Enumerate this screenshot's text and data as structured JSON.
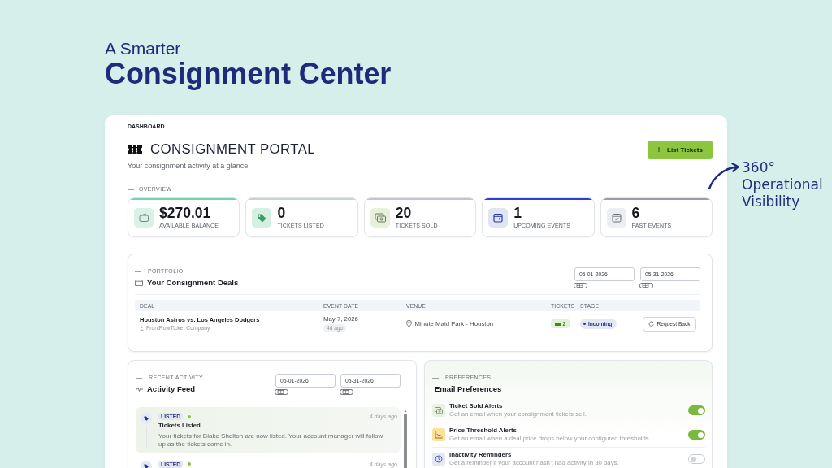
{
  "hero": {
    "kicker": "A Smarter",
    "title": "Consignment Center"
  },
  "annotation": {
    "text": "360° Operational Visibility"
  },
  "breadcrumb": "DASHBOARD",
  "header": {
    "title": "CONSIGNMENT PORTAL",
    "subtitle": "Your consignment activity at a glance.",
    "action": "List Tickets"
  },
  "overview": {
    "label": "OVERVIEW",
    "stats": [
      {
        "value": "$270.01",
        "label": "AVAILABLE BALANCE",
        "color": "#74d3a8"
      },
      {
        "value": "0",
        "label": "TICKETS LISTED",
        "color": "#c8d2ce"
      },
      {
        "value": "20",
        "label": "TICKETS SOLD",
        "color": "#c2c5cb"
      },
      {
        "value": "1",
        "label": "UPCOMING EVENTS",
        "color": "#2c3ed8"
      },
      {
        "value": "6",
        "label": "PAST EVENTS",
        "color": "#999da5"
      }
    ]
  },
  "portfolio": {
    "label": "PORTFOLIO",
    "title": "Your Consignment Deals",
    "dates": [
      "05-01-2026",
      "05-31-2026"
    ],
    "columns": [
      "DEAL",
      "EVENT DATE",
      "VENUE",
      "TICKETS",
      "STAGE"
    ],
    "rows": [
      {
        "deal": "Houston Astros vs. Los Angeles Dodgers",
        "seller": "FrontRowTicket Company",
        "event_date": "May 7, 2026",
        "age": "4d ago",
        "venue": "Minute Maid Park - Houston",
        "tickets": "2",
        "stage": "Incoming",
        "action": "Request Back"
      }
    ]
  },
  "activity": {
    "label": "RECENT ACTIVITY",
    "title": "Activity Feed",
    "dates": [
      "05-01-2026",
      "05-31-2026"
    ],
    "items": [
      {
        "tag": "LISTED",
        "unread": true,
        "time": "4 days ago",
        "title": "Tickets Listed",
        "body": "Your tickets for Blake Shelton are now listed. Your account manager will follow up as the tickets come in.",
        "highlighted": true
      },
      {
        "tag": "LISTED",
        "unread": true,
        "time": "4 days ago",
        "highlighted": false
      }
    ]
  },
  "preferences": {
    "label": "PREFERENCES",
    "title": "Email Preferences",
    "items": [
      {
        "title": "Ticket Sold Alerts",
        "description": "Get an email when your consignment tickets sell.",
        "on": true
      },
      {
        "title": "Price Threshold Alerts",
        "description": "Get an email when a deal price drops below your configured thresholds.",
        "on": true
      },
      {
        "title": "Inactivity Reminders",
        "description": "Get a reminder if your account hasn't had activity in 30 days.",
        "on": false
      }
    ]
  }
}
